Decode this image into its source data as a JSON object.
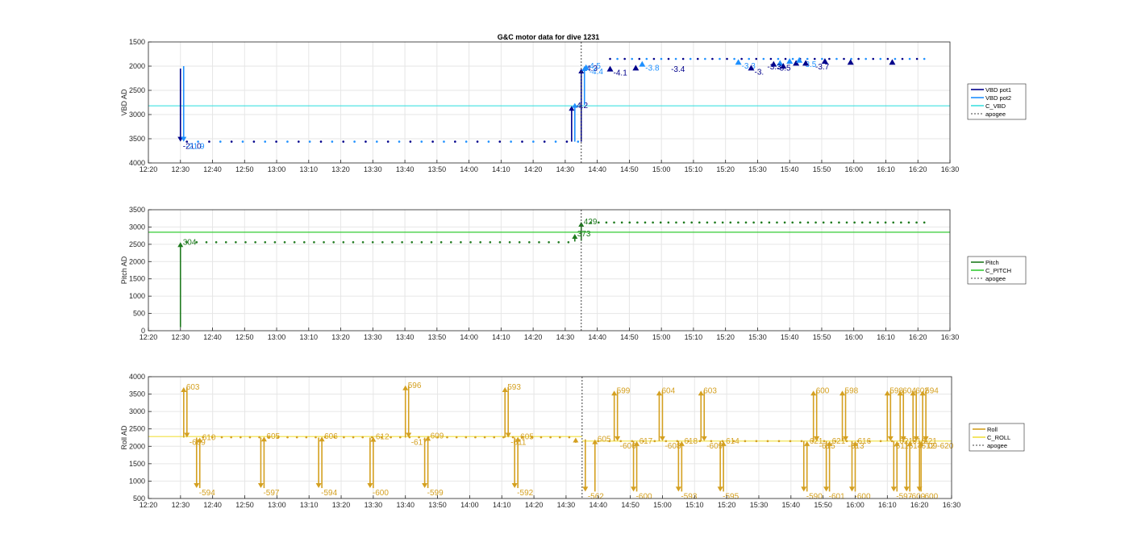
{
  "title": "G&C motor data for dive 1231",
  "chart_data": [
    {
      "type": "scatter",
      "ylabel": "VBD AD",
      "ylim": [
        1500,
        4000
      ],
      "y_reversed": true,
      "yticks": [
        "1500",
        "2000",
        "2500",
        "3000",
        "3500",
        "4000"
      ],
      "xlim": [
        "12:20",
        "16:30"
      ],
      "xticks": [
        "12:20",
        "12:30",
        "12:40",
        "12:50",
        "13:00",
        "13:10",
        "13:20",
        "13:30",
        "13:40",
        "13:50",
        "14:00",
        "14:10",
        "14:20",
        "14:30",
        "14:40",
        "14:50",
        "15:00",
        "15:10",
        "15:20",
        "15:30",
        "15:40",
        "15:50",
        "16:00",
        "16:10",
        "16:20",
        "16:30"
      ],
      "legend": [
        "VBD pot1",
        "VBD pot2",
        "C_VBD",
        "apogee"
      ],
      "legend_position": "right",
      "colors": {
        "pot1": "#00008b",
        "pot2": "#1e90ff",
        "ref": "#40e0e0",
        "apogee": "#404040"
      },
      "reference_line": 2820,
      "apogee": "14:35",
      "moves": [
        {
          "t": "12:30",
          "from": 2050,
          "to": 3560,
          "series": "pot1",
          "label": "-21.0"
        },
        {
          "t": "12:31",
          "from": 2000,
          "to": 3560,
          "series": "pot2",
          "label": "-21.9"
        },
        {
          "t": "14:32",
          "from": 3560,
          "to": 2820,
          "series": "pot1",
          "label": "-4.2"
        },
        {
          "t": "14:33",
          "from": 3560,
          "to": 2760,
          "series": "pot2",
          "label": ""
        },
        {
          "t": "14:35",
          "from": 3560,
          "to": 2050,
          "series": "pot1",
          "label": "-4.3"
        },
        {
          "t": "14:36",
          "from": 2800,
          "to": 2000,
          "series": "pot2",
          "label": "-4.5"
        }
      ],
      "small_markers": [
        {
          "t": "14:36.5",
          "y": 2030,
          "series": "pot2",
          "label": "-4.4"
        },
        {
          "t": "14:44",
          "y": 2060,
          "series": "pot1",
          "label": "-4.1"
        },
        {
          "t": "14:52",
          "y": 2040,
          "series": "pot1",
          "label": ""
        },
        {
          "t": "14:54",
          "y": 1960,
          "series": "pot2",
          "label": "-3.8"
        },
        {
          "t": "15:24",
          "y": 1920,
          "series": "pot2",
          "label": "-3.3"
        },
        {
          "t": "15:28",
          "y": 2040,
          "series": "pot1",
          "label": "-3."
        },
        {
          "t": "15:35",
          "y": 1960,
          "series": "pot1",
          "label": "-3.5"
        },
        {
          "t": "15:37",
          "y": 1940,
          "series": "pot2",
          "label": ""
        },
        {
          "t": "15:38",
          "y": 2000,
          "series": "pot1",
          "label": ""
        },
        {
          "t": "15:40",
          "y": 1900,
          "series": "pot2",
          "label": ""
        },
        {
          "t": "15:42",
          "y": 1940,
          "series": "pot1",
          "label": ""
        },
        {
          "t": "15:43",
          "y": 1880,
          "series": "pot2",
          "label": "-3.5"
        },
        {
          "t": "15:45",
          "y": 1940,
          "series": "pot1",
          "label": ""
        },
        {
          "t": "15:51",
          "y": 1900,
          "series": "pot1",
          "label": ""
        },
        {
          "t": "15:59",
          "y": 1920,
          "series": "pot1",
          "label": ""
        },
        {
          "t": "16:12",
          "y": 1920,
          "series": "pot1",
          "label": ""
        }
      ],
      "dot_runs": [
        {
          "from": "12:32",
          "to": "14:34",
          "count": 36,
          "y": 3560
        },
        {
          "from": "14:44",
          "to": "16:22",
          "count": 44,
          "y": 1850
        }
      ],
      "extra_labels": [
        {
          "t": "15:03",
          "y": 2050,
          "text": "-3.4"
        },
        {
          "t": "15:33",
          "y": 2000,
          "text": "-3.3"
        },
        {
          "t": "15:48",
          "y": 2000,
          "text": "-3.7"
        }
      ]
    },
    {
      "type": "scatter",
      "ylabel": "Pitch AD",
      "ylim": [
        0,
        3500
      ],
      "yticks": [
        "0",
        "500",
        "1000",
        "1500",
        "2000",
        "2500",
        "3000",
        "3500"
      ],
      "xticks": [
        "12:20",
        "12:30",
        "12:40",
        "12:50",
        "13:00",
        "13:10",
        "13:20",
        "13:30",
        "13:40",
        "13:50",
        "14:00",
        "14:10",
        "14:20",
        "14:30",
        "14:40",
        "14:50",
        "15:00",
        "15:10",
        "15:20",
        "15:30",
        "15:40",
        "15:50",
        "16:00",
        "16:10",
        "16:20",
        "16:30"
      ],
      "legend": [
        "Pitch",
        "C_PITCH",
        "apogee"
      ],
      "legend_position": "right",
      "colors": {
        "pitch": "#1e7a1e",
        "ref": "#33cc33",
        "apogee": "#404040"
      },
      "reference_line": 2850,
      "moves": [
        {
          "t": "12:30",
          "from": 100,
          "to": 2560,
          "label": "304"
        },
        {
          "t": "14:33",
          "from": 2580,
          "to": 2800,
          "label": "373"
        },
        {
          "t": "14:35",
          "from": 2600,
          "to": 3150,
          "label": "429"
        }
      ],
      "dot_runs": [
        {
          "from": "12:32",
          "to": "14:31",
          "count": 40,
          "y": 2560
        },
        {
          "from": "14:38",
          "to": "16:22",
          "count": 44,
          "y": 3130
        }
      ]
    },
    {
      "type": "scatter",
      "ylabel": "Roll AD",
      "ylim": [
        500,
        4000
      ],
      "yticks": [
        "500",
        "1000",
        "1500",
        "2000",
        "2500",
        "3000",
        "3500",
        "4000"
      ],
      "xticks": [
        "12:20",
        "12:30",
        "12:40",
        "12:50",
        "13:00",
        "13:10",
        "13:20",
        "13:30",
        "13:40",
        "13:50",
        "14:00",
        "14:10",
        "14:20",
        "14:30",
        "14:40",
        "14:50",
        "15:00",
        "15:10",
        "15:20",
        "15:30",
        "15:40",
        "15:50",
        "16:00",
        "16:10",
        "16:20",
        "16:30"
      ],
      "legend": [
        "Roll",
        "C_ROLL",
        "apogee"
      ],
      "legend_position": "right",
      "colors": {
        "roll": "#d4a020",
        "ref": "#f0e040",
        "apogee": "#404040"
      },
      "reference_line": 2280,
      "reference_line_after": 2150,
      "moves": [
        {
          "t": "12:31",
          "from": 2250,
          "to": 3700,
          "label": "603"
        },
        {
          "t": "12:32",
          "from": 3700,
          "to": 2250,
          "label": "-609"
        },
        {
          "t": "12:35",
          "from": 2250,
          "to": 800,
          "label": "-594"
        },
        {
          "t": "12:36",
          "from": 800,
          "to": 2250,
          "label": "610"
        },
        {
          "t": "12:55",
          "from": 2250,
          "to": 800,
          "label": "-597"
        },
        {
          "t": "12:56",
          "from": 800,
          "to": 2280,
          "label": "605"
        },
        {
          "t": "13:13",
          "from": 2250,
          "to": 800,
          "label": "-594"
        },
        {
          "t": "13:14",
          "from": 800,
          "to": 2280,
          "label": "606"
        },
        {
          "t": "13:29",
          "from": 2250,
          "to": 800,
          "label": "-600"
        },
        {
          "t": "13:30",
          "from": 800,
          "to": 2270,
          "label": "612"
        },
        {
          "t": "13:40",
          "from": 2250,
          "to": 3750,
          "label": "596"
        },
        {
          "t": "13:41",
          "from": 3750,
          "to": 2250,
          "label": "-617"
        },
        {
          "t": "13:46",
          "from": 2250,
          "to": 800,
          "label": "-599"
        },
        {
          "t": "13:47",
          "from": 800,
          "to": 2300,
          "label": "609"
        },
        {
          "t": "14:11",
          "from": 2250,
          "to": 3700,
          "label": "593"
        },
        {
          "t": "14:12",
          "from": 3700,
          "to": 2250,
          "label": "-611"
        },
        {
          "t": "14:14",
          "from": 2250,
          "to": 800,
          "label": "-592"
        },
        {
          "t": "14:15",
          "from": 800,
          "to": 2270,
          "label": "605"
        },
        {
          "t": "14:33",
          "from": 2100,
          "to": 2250,
          "label": ""
        },
        {
          "t": "14:36",
          "from": 2200,
          "to": 700,
          "label": "-562"
        },
        {
          "t": "14:39",
          "from": 700,
          "to": 2200,
          "label": "605"
        },
        {
          "t": "14:45",
          "from": 2150,
          "to": 3600,
          "label": "599"
        },
        {
          "t": "14:46",
          "from": 3600,
          "to": 2150,
          "label": "-606"
        },
        {
          "t": "14:51",
          "from": 2150,
          "to": 700,
          "label": "-600"
        },
        {
          "t": "14:52",
          "from": 700,
          "to": 2150,
          "label": "617"
        },
        {
          "t": "14:59",
          "from": 2150,
          "to": 3600,
          "label": "604"
        },
        {
          "t": "15:00",
          "from": 3600,
          "to": 2150,
          "label": "-608"
        },
        {
          "t": "15:05",
          "from": 2150,
          "to": 700,
          "label": "-593"
        },
        {
          "t": "15:06",
          "from": 700,
          "to": 2150,
          "label": "618"
        },
        {
          "t": "15:12",
          "from": 2150,
          "to": 3600,
          "label": "603"
        },
        {
          "t": "15:13",
          "from": 3600,
          "to": 2150,
          "label": "-609"
        },
        {
          "t": "15:18",
          "from": 2150,
          "to": 700,
          "label": "-595"
        },
        {
          "t": "15:19",
          "from": 700,
          "to": 2150,
          "label": "614"
        },
        {
          "t": "15:44",
          "from": 2150,
          "to": 700,
          "label": "-590"
        },
        {
          "t": "15:45",
          "from": 700,
          "to": 2150,
          "label": "621"
        },
        {
          "t": "15:47",
          "from": 2150,
          "to": 3600,
          "label": "600"
        },
        {
          "t": "15:48",
          "from": 3600,
          "to": 2150,
          "label": "-615"
        },
        {
          "t": "15:51",
          "from": 2150,
          "to": 700,
          "label": "-601"
        },
        {
          "t": "15:52",
          "from": 700,
          "to": 2150,
          "label": "621"
        },
        {
          "t": "15:56",
          "from": 2150,
          "to": 3600,
          "label": "598"
        },
        {
          "t": "15:57",
          "from": 3600,
          "to": 2150,
          "label": "-613"
        },
        {
          "t": "15:59",
          "from": 2150,
          "to": 700,
          "label": "-600"
        },
        {
          "t": "16:00",
          "from": 700,
          "to": 2150,
          "label": "616"
        },
        {
          "t": "16:10",
          "from": 2150,
          "to": 3600,
          "label": "598"
        },
        {
          "t": "16:11",
          "from": 3600,
          "to": 2150,
          "label": "-611"
        },
        {
          "t": "16:12",
          "from": 2150,
          "to": 700,
          "label": "-597"
        },
        {
          "t": "16:13",
          "from": 700,
          "to": 2150,
          "label": "621"
        },
        {
          "t": "16:14",
          "from": 2150,
          "to": 3600,
          "label": "604"
        },
        {
          "t": "16:15",
          "from": 3600,
          "to": 2150,
          "label": "-614"
        },
        {
          "t": "16:16",
          "from": 2150,
          "to": 700,
          "label": "-600"
        },
        {
          "t": "16:17",
          "from": 700,
          "to": 2150,
          "label": "616"
        },
        {
          "t": "16:18",
          "from": 2150,
          "to": 3600,
          "label": "602"
        },
        {
          "t": "16:19",
          "from": 3600,
          "to": 2150,
          "label": "-612"
        },
        {
          "t": "16:20",
          "from": 2150,
          "to": 700,
          "label": "-600"
        },
        {
          "t": "16:20.5",
          "from": 700,
          "to": 2150,
          "label": "621"
        },
        {
          "t": "16:21",
          "from": 2150,
          "to": 3600,
          "label": "594"
        },
        {
          "t": "16:22",
          "from": 3600,
          "to": 2150,
          "label": "09-620"
        }
      ],
      "dot_runs": [
        {
          "from": "12:37",
          "to": "14:31",
          "count": 40,
          "y": 2260
        },
        {
          "from": "14:40",
          "to": "16:22",
          "count": 30,
          "y": 2150
        }
      ]
    }
  ]
}
